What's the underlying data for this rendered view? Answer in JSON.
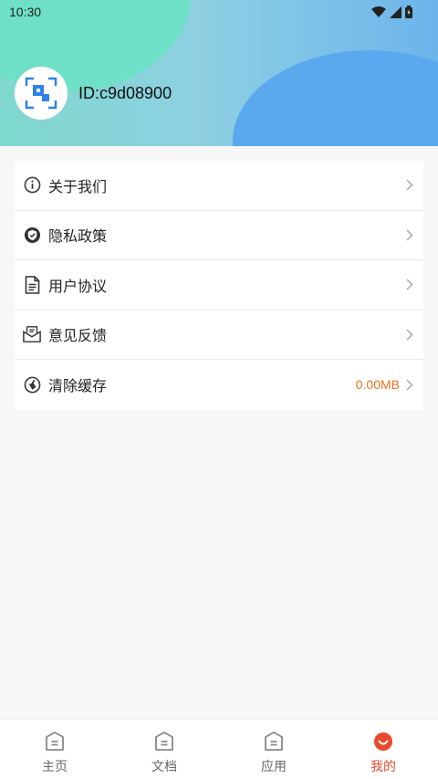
{
  "status_bar": {
    "time": "10:30"
  },
  "profile": {
    "id_text": "ID:c9d08900"
  },
  "menu": [
    {
      "label": "关于我们",
      "icon": "info-icon",
      "value": ""
    },
    {
      "label": "隐私政策",
      "icon": "shield-icon",
      "value": ""
    },
    {
      "label": "用户协议",
      "icon": "document-icon",
      "value": ""
    },
    {
      "label": "意见反馈",
      "icon": "mail-icon",
      "value": ""
    },
    {
      "label": "清除缓存",
      "icon": "broom-icon",
      "value": "0.00MB"
    }
  ],
  "tabs": [
    {
      "label": "主页",
      "icon": "home-icon",
      "active": false
    },
    {
      "label": "文档",
      "icon": "home-icon",
      "active": false
    },
    {
      "label": "应用",
      "icon": "home-icon",
      "active": false
    },
    {
      "label": "我的",
      "icon": "profile-icon",
      "active": true
    }
  ],
  "colors": {
    "accent": "#e8492d",
    "cache_value": "#e8711c"
  }
}
